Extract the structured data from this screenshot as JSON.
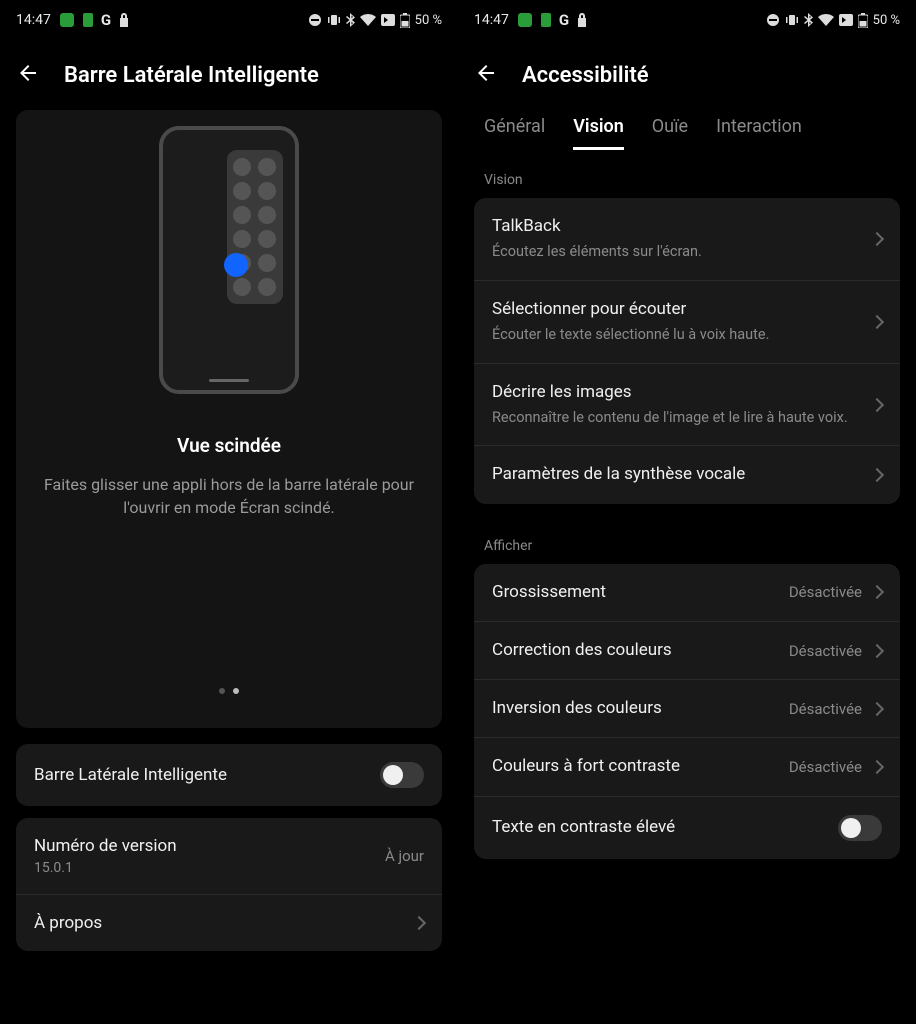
{
  "status": {
    "time": "14:47",
    "battery": "50 %"
  },
  "left": {
    "title": "Barre Latérale Intelligente",
    "preview": {
      "title": "Vue scindée",
      "description": "Faites glisser une appli hors de la barre latérale pour l'ouvrir en mode Écran scindé."
    },
    "toggle_label": "Barre Latérale Intelligente",
    "version": {
      "title": "Numéro de version",
      "value": "15.0.1",
      "status": "À jour"
    },
    "about": "À propos"
  },
  "right": {
    "title": "Accessibilité",
    "tabs": [
      "Général",
      "Vision",
      "Ouïe",
      "Interaction"
    ],
    "active_tab": "Vision",
    "section_vision": "Vision",
    "vision_items": [
      {
        "title": "TalkBack",
        "desc": "Écoutez les éléments sur l'écran."
      },
      {
        "title": "Sélectionner pour écouter",
        "desc": "Écouter le texte sélectionné lu à voix haute."
      },
      {
        "title": "Décrire les images",
        "desc": "Reconnaître le contenu de l'image et le lire à haute voix."
      },
      {
        "title": "Paramètres de la synthèse vocale",
        "desc": ""
      }
    ],
    "section_display": "Afficher",
    "display_items": [
      {
        "title": "Grossissement",
        "status": "Désactivée"
      },
      {
        "title": "Correction des couleurs",
        "status": "Désactivée"
      },
      {
        "title": "Inversion des couleurs",
        "status": "Désactivée"
      },
      {
        "title": "Couleurs à fort contraste",
        "status": "Désactivée"
      },
      {
        "title": "Texte en contraste élevé",
        "status": ""
      }
    ]
  }
}
